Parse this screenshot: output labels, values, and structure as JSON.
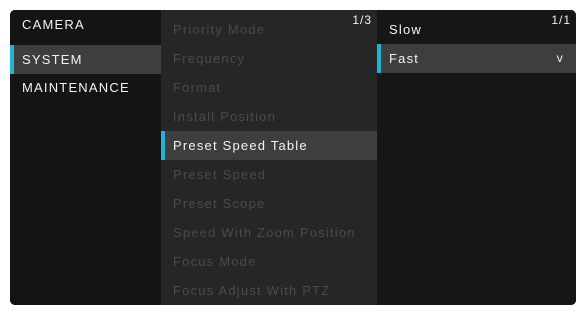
{
  "menu": {
    "main": [
      {
        "label": "CAMERA",
        "selected": false
      },
      {
        "label": "SYSTEM",
        "selected": true
      },
      {
        "label": "MAINTENANCE",
        "selected": false
      }
    ],
    "sub": {
      "page": "1/3",
      "items": [
        {
          "label": "Priority Mode"
        },
        {
          "label": "Frequency"
        },
        {
          "label": "Format"
        },
        {
          "label": "Install Position"
        },
        {
          "label": "Preset Speed Table",
          "selected": true
        },
        {
          "label": "Preset Speed"
        },
        {
          "label": "Preset Scope"
        },
        {
          "label": "Speed With Zoom Position"
        },
        {
          "label": "Focus Mode"
        },
        {
          "label": "Focus Adjust With PTZ"
        }
      ]
    },
    "options": {
      "page": "1/1",
      "items": [
        {
          "label": "Slow"
        },
        {
          "label": "Fast",
          "selected": true,
          "mark": "v"
        }
      ]
    }
  },
  "colors": {
    "accent": "#1fb3d6",
    "selected_bg": "#3e3e3e",
    "disabled_text": "#4a4a4a"
  }
}
